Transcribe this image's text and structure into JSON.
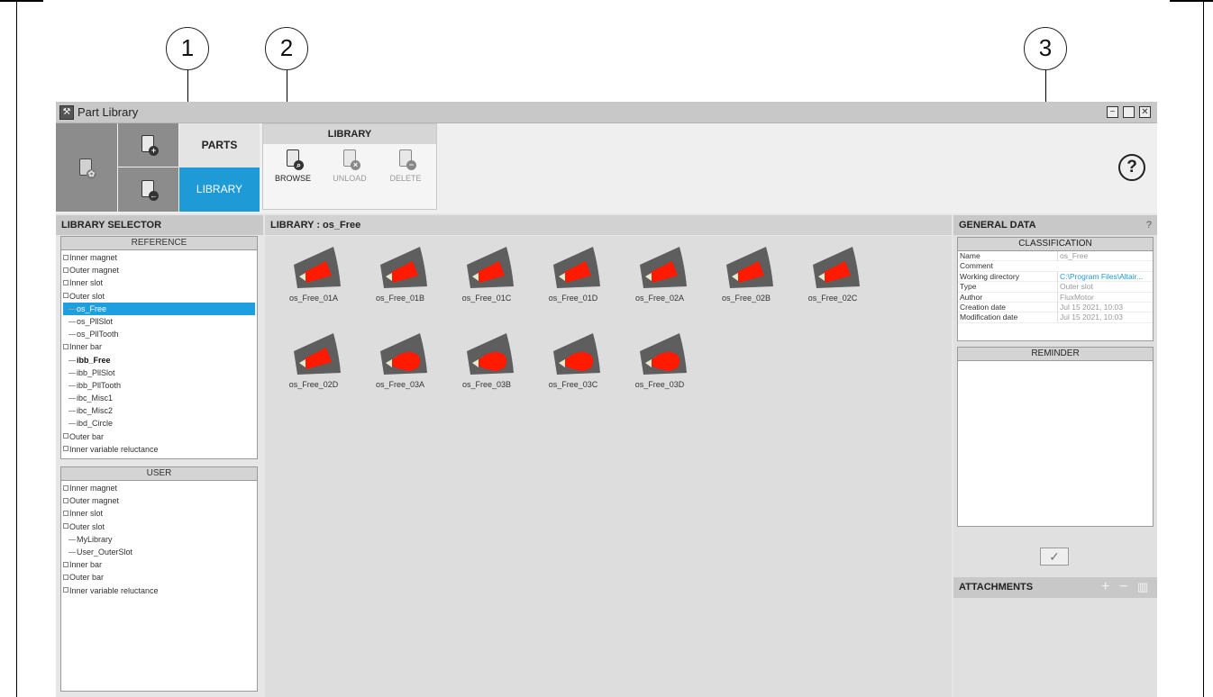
{
  "callouts": [
    "1",
    "2",
    "3"
  ],
  "window": {
    "title": "Part Library",
    "icon": "part-library-logo",
    "controls": [
      "minimize",
      "maximize",
      "close"
    ]
  },
  "ribbon": {
    "tabs": {
      "parts": "PARTS",
      "library": "LIBRARY"
    },
    "library_group": {
      "title": "LIBRARY",
      "browse": "BROWSE",
      "unload": "UNLOAD",
      "delete": "DELETE"
    },
    "help": "?"
  },
  "library_selector": {
    "title": "LIBRARY SELECTOR",
    "reference": {
      "header": "REFERENCE",
      "items": [
        {
          "label": "Inner magnet",
          "level": 0
        },
        {
          "label": "Outer magnet",
          "level": 0
        },
        {
          "label": "Inner slot",
          "level": 0
        },
        {
          "label": "Outer slot",
          "level": 0
        },
        {
          "label": "os_Free",
          "level": 1,
          "selected": true
        },
        {
          "label": "os_PllSlot",
          "level": 1
        },
        {
          "label": "os_PllTooth",
          "level": 1
        },
        {
          "label": "Inner bar",
          "level": 0
        },
        {
          "label": "ibb_Free",
          "level": 1,
          "bold": true
        },
        {
          "label": "ibb_PllSlot",
          "level": 1
        },
        {
          "label": "ibb_PllTooth",
          "level": 1
        },
        {
          "label": "ibc_Misc1",
          "level": 1
        },
        {
          "label": "ibc_Misc2",
          "level": 1
        },
        {
          "label": "ibd_Circle",
          "level": 1
        },
        {
          "label": "Outer bar",
          "level": 0
        },
        {
          "label": "Inner variable reluctance",
          "level": 0
        }
      ]
    },
    "user": {
      "header": "USER",
      "items": [
        {
          "label": "Inner magnet",
          "level": 0
        },
        {
          "label": "Outer magnet",
          "level": 0
        },
        {
          "label": "Inner slot",
          "level": 0
        },
        {
          "label": "Outer slot",
          "level": 0
        },
        {
          "label": "MyLibrary",
          "level": 1
        },
        {
          "label": "User_OuterSlot",
          "level": 1
        },
        {
          "label": "Inner bar",
          "level": 0
        },
        {
          "label": "Outer bar",
          "level": 0
        },
        {
          "label": "Inner variable reluctance",
          "level": 0
        }
      ]
    }
  },
  "library": {
    "title": "LIBRARY : os_Free",
    "parts": [
      {
        "label": "os_Free_01A",
        "shape": "trap"
      },
      {
        "label": "os_Free_01B",
        "shape": "trap"
      },
      {
        "label": "os_Free_01C",
        "shape": "trap"
      },
      {
        "label": "os_Free_01D",
        "shape": "trap"
      },
      {
        "label": "os_Free_02A",
        "shape": "trap"
      },
      {
        "label": "os_Free_02B",
        "shape": "trap"
      },
      {
        "label": "os_Free_02C",
        "shape": "trap"
      },
      {
        "label": "os_Free_02D",
        "shape": "trap"
      },
      {
        "label": "os_Free_03A",
        "shape": "round"
      },
      {
        "label": "os_Free_03B",
        "shape": "round"
      },
      {
        "label": "os_Free_03C",
        "shape": "round"
      },
      {
        "label": "os_Free_03D",
        "shape": "round"
      }
    ],
    "colors": {
      "core": "#5e5e5e",
      "slot": "#ff1a00",
      "opening": "#f2e8c8"
    }
  },
  "general_data": {
    "title": "GENERAL DATA",
    "help": "?",
    "classification": {
      "header": "CLASSIFICATION",
      "rows": [
        {
          "key": "Name",
          "value": "os_Free"
        },
        {
          "key": "Comment",
          "value": ""
        },
        {
          "key": "Working directory",
          "value": "C:\\Program Files\\Altair...",
          "link": true
        },
        {
          "key": "Type",
          "value": "Outer slot"
        },
        {
          "key": "Author",
          "value": "FluxMotor"
        },
        {
          "key": "Creation date",
          "value": "Jul 15 2021, 10:03"
        },
        {
          "key": "Modification date",
          "value": "Jul 15 2021, 10:03"
        }
      ]
    },
    "reminder": {
      "header": "REMINDER"
    },
    "confirm_icon": "check-icon"
  },
  "attachments": {
    "title": "ATTACHMENTS",
    "add": "+",
    "remove": "−"
  }
}
